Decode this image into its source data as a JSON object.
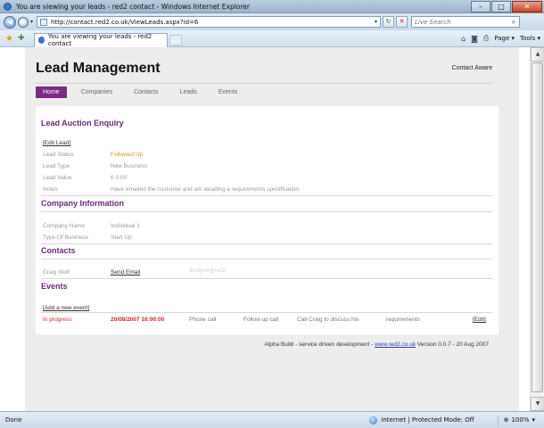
{
  "window": {
    "title": "You are viewing your leads - red2 contact - Windows Internet Explorer",
    "minimize": "–",
    "maximize": "□",
    "close": "✕"
  },
  "browser": {
    "address": "http://contact.red2.co.uk/ViewLeads.aspx?id=6",
    "search_placeholder": "Live Search",
    "tab_title": "You are viewing your leads - red2 contact",
    "page_menu": "Page ▾",
    "tools_menu": "Tools ▾",
    "icons": [
      "back-icon",
      "forward-icon",
      "refresh-icon",
      "stop-icon",
      "favorites-star-icon",
      "add-favorites-icon",
      "home-icon",
      "feeds-icon",
      "print-icon",
      "search-icon"
    ]
  },
  "site": {
    "brand": "Lead Management",
    "company": "Contact Aware",
    "nav": [
      "Home",
      "Companies",
      "Contacts",
      "Leads",
      "Events"
    ],
    "active_nav": "Home"
  },
  "lead": {
    "heading": "Lead Auction Enquiry",
    "edit_link": "[Edit Lead]",
    "fields": [
      {
        "label": "Lead Status",
        "value": "Followed Up"
      },
      {
        "label": "Lead Type",
        "value": "New Business"
      },
      {
        "label": "Lead Value",
        "value": "£ 0.00"
      },
      {
        "label": "Notes",
        "value": "Have emailed the customer and am awaiting a requirements specification"
      }
    ],
    "status_color": "#d29a1b"
  },
  "company_info": {
    "heading": "Company Information",
    "fields": [
      {
        "label": "Company Name",
        "value": "Individual 1"
      },
      {
        "label": "Type Of Business",
        "value": "Start Up"
      }
    ]
  },
  "contacts": {
    "heading": "Contacts",
    "rows": [
      {
        "name": "Craig Wolf",
        "action": "Send Email",
        "extra": "designer@red2"
      }
    ]
  },
  "events": {
    "heading": "Events",
    "add_link": "[Add a new event]",
    "rows": [
      {
        "status": "In progress",
        "datetime": "20/08/2007 16:00:00",
        "type": "Phone call",
        "action": "Follow up call",
        "note": "Call Craig to discuss his",
        "note2": "requirements",
        "edit": "[Edit]"
      }
    ]
  },
  "footer": {
    "text_before": "Alpha Build - service driven development - ",
    "link": "www.red2.co.uk",
    "text_after": " Version 0.0.7 - 20 Aug 2007"
  },
  "status_bar": {
    "left": "Done",
    "zone": "Internet | Protected Mode: Off",
    "zoom": "100%"
  },
  "colors": {
    "accent": "#7b2b84",
    "heading": "#6b2a78",
    "event_red": "#d02a2a"
  }
}
